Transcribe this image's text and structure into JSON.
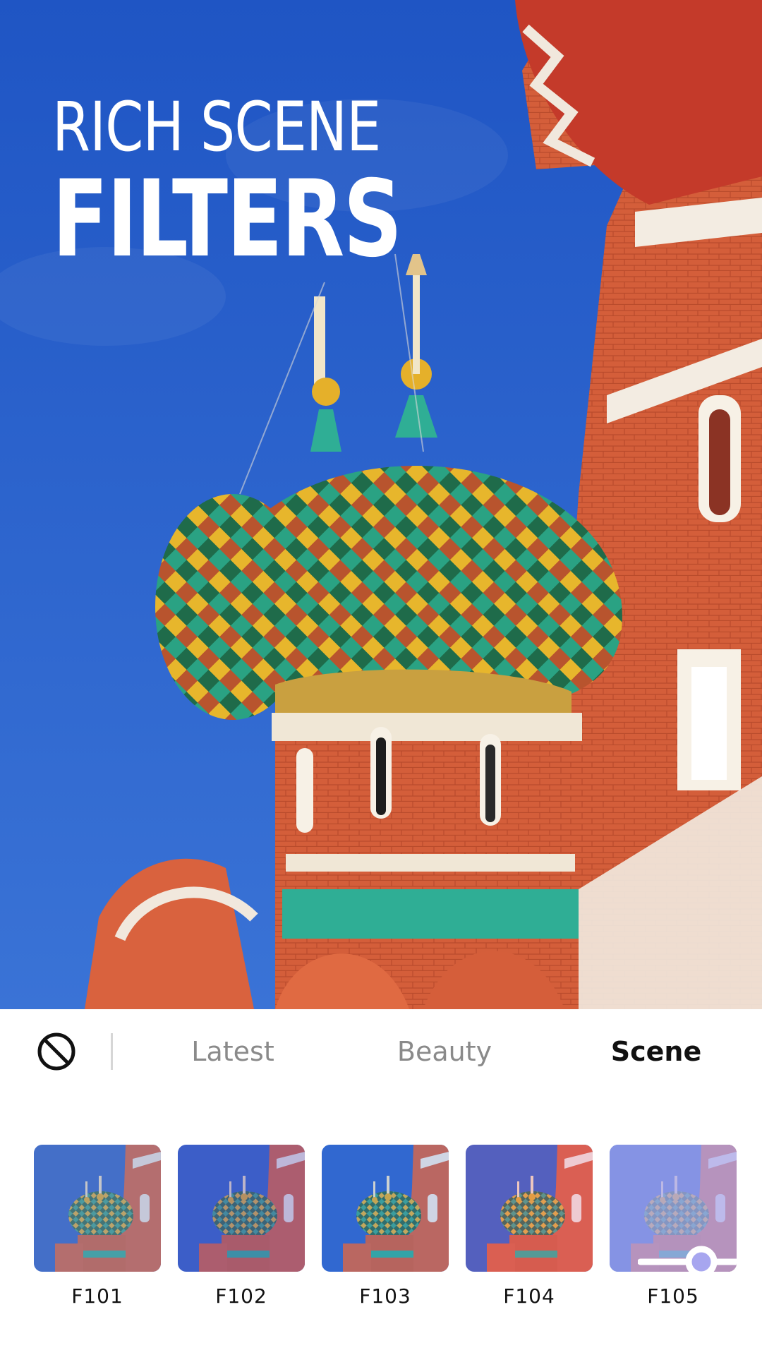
{
  "headline": {
    "line1": "RICH SCENE",
    "line2": "FILTERS"
  },
  "tabs": {
    "no_filter_icon": "no-filter-icon",
    "items": [
      {
        "label": "Latest",
        "active": false
      },
      {
        "label": "Beauty",
        "active": false
      },
      {
        "label": "Scene",
        "active": true
      }
    ]
  },
  "filters": [
    {
      "label": "F101",
      "tint": "#6f86c8",
      "selected": false
    },
    {
      "label": "F102",
      "tint": "#5a55c9",
      "selected": false
    },
    {
      "label": "F103",
      "tint": "#3f7cf0",
      "selected": false
    },
    {
      "label": "F104",
      "tint": "#4e7af0",
      "selected": false
    },
    {
      "label": "F105",
      "tint": "#a7a6ef",
      "selected": true,
      "icon": "adjust-slider-icon"
    }
  ],
  "colors": {
    "sky": "#2d63c8",
    "brick": "#d8623f",
    "teal": "#2fae95",
    "gold": "#e8b72a",
    "active_tab": "#111111",
    "inactive_tab": "#8a8a8a"
  }
}
